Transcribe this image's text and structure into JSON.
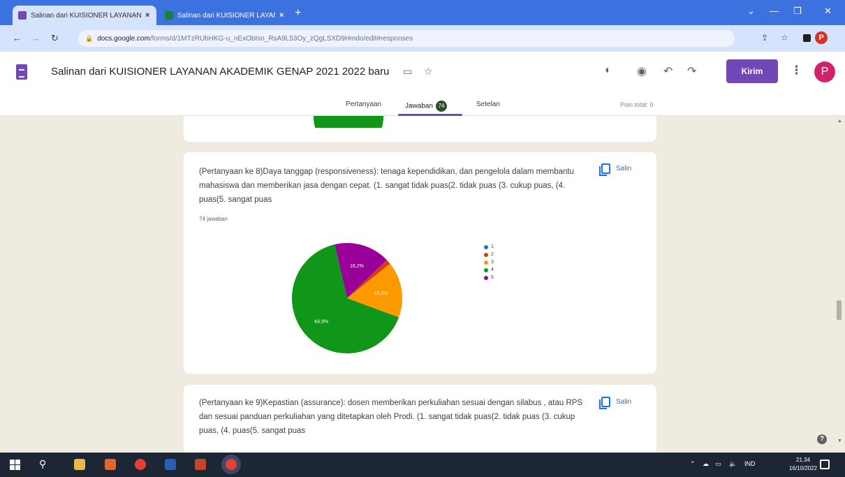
{
  "browser": {
    "tabs": [
      {
        "label": "Salinan dari KUISIONER LAYANAN AKADEMIK",
        "active": true,
        "icon": "forms-icon"
      },
      {
        "label": "Salinan dari KUISIONER LAYANAN AKADEMIK",
        "active": false,
        "icon": "sheets-icon"
      }
    ],
    "url_host": "docs.google.com",
    "url_path": "/forms/d/1MTzRUbHKG-u_nExObIsn_RsA9L53Oy_zQgLSXD9Hmdo/edit#responses"
  },
  "form": {
    "title": "Salinan dari KUISIONER LAYANAN AKADEMIK GENAP 2021 2022 baru",
    "send_label": "Kirim",
    "profile_initial": "P",
    "tabs": {
      "questions": "Pertanyaan",
      "responses": "Jawaban",
      "responses_count": "74",
      "settings": "Setelan"
    },
    "points": "Poin total: 0"
  },
  "questions": [
    {
      "text": "(Pertanyaan ke 8)Daya tanggap (responsiveness): tenaga kependidikan, dan pengelola dalam membantu mahasiswa dan memberikan jasa dengan cepat. (1.        sangat tidak puas(2.  tidak puas (3.        cukup puas, (4.    puas(5.  sangat puas",
      "copy_label": "Salin",
      "count_label": "74 jawaban"
    },
    {
      "text": "(Pertanyaan ke 9)Kepastian (assurance):  dosen memberikan perkuliahan sesuai dengan silabus , atau RPS dan sesuai panduan perkuliahan yang ditetapkan oleh Prodi. (1.    sangat tidak puas(2.  tidak puas (3.        cukup puas, (4.    puas(5.  sangat puas",
      "copy_label": "Salin"
    }
  ],
  "chart_data": {
    "type": "pie",
    "categories": [
      "1",
      "2",
      "3",
      "4",
      "5"
    ],
    "values": [
      0,
      1.4,
      16.2,
      64.9,
      16.2
    ],
    "data_labels": [
      "",
      "",
      "16,2%",
      "64,9%",
      "16,2%"
    ],
    "colors": [
      "#3366cc",
      "#dc3912",
      "#ff9900",
      "#109618",
      "#990099"
    ],
    "legend": "right"
  },
  "taskbar": {
    "time": "21.34",
    "date": "16/10/2022",
    "lang": "IND"
  }
}
